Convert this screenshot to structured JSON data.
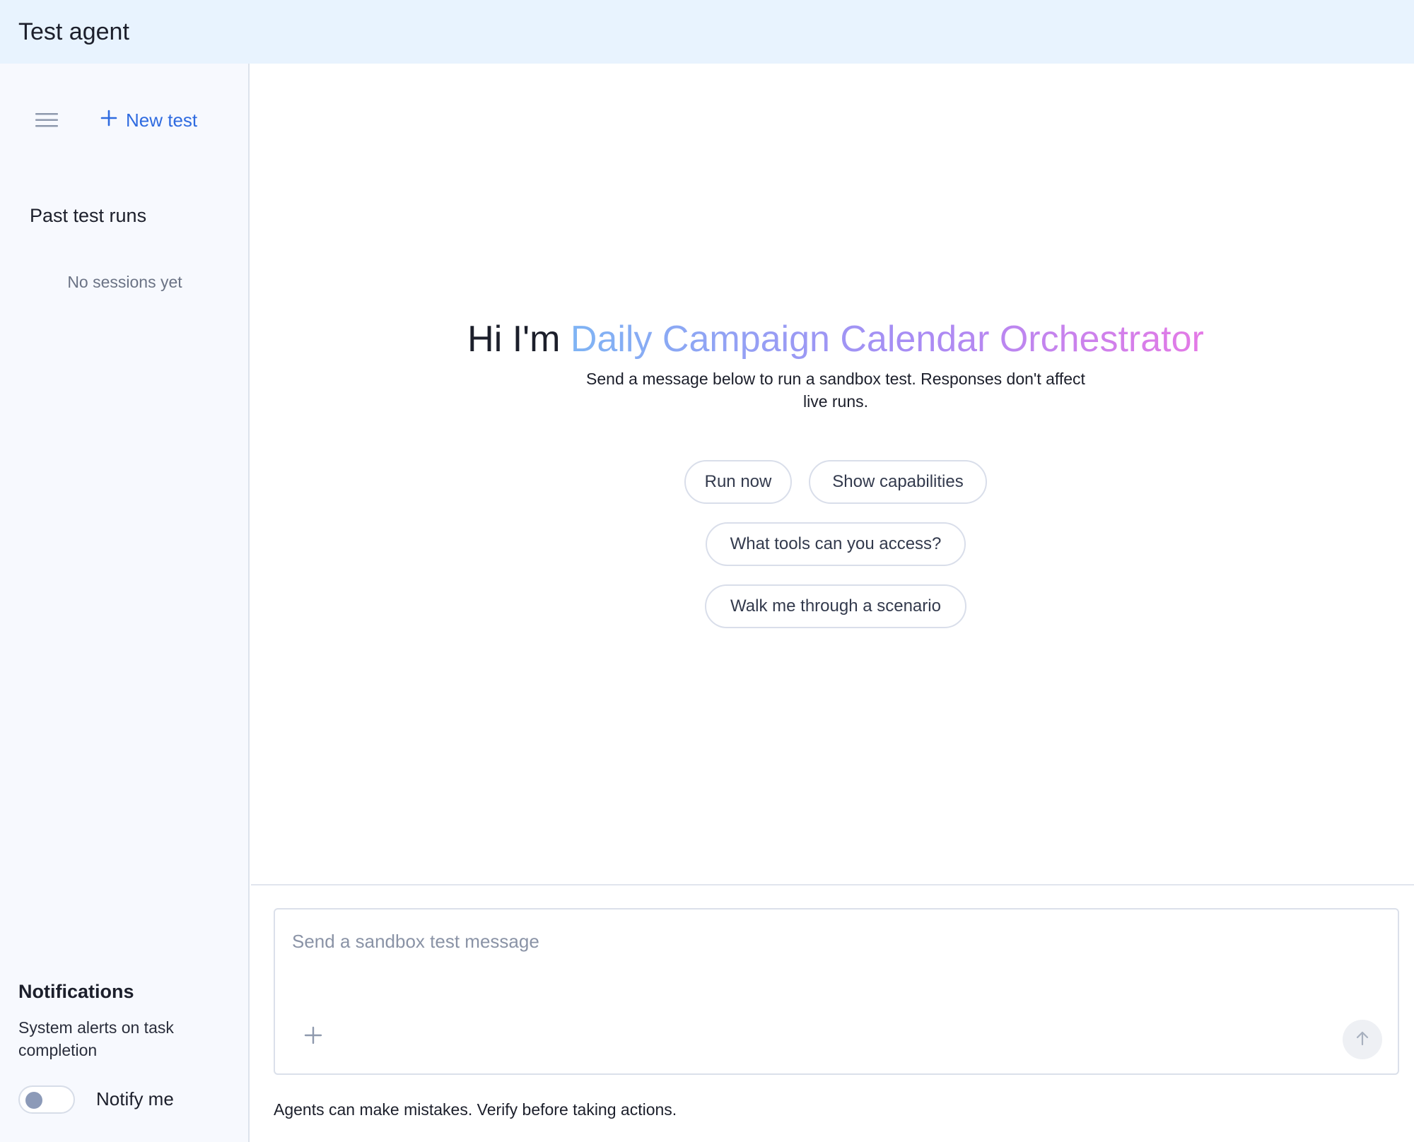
{
  "header": {
    "title": "Test agent"
  },
  "sidebar": {
    "menu_icon": "hamburger-menu-icon",
    "new_test_label": "New test",
    "new_test_icon": "plus-icon",
    "past_runs_title": "Past test runs",
    "empty_state": "No sessions yet",
    "notifications": {
      "title": "Notifications",
      "description": "System alerts on task completion",
      "toggle_label": "Notify me",
      "toggle_on": false
    }
  },
  "main": {
    "greeting_prefix": "Hi I'm",
    "agent_name": "Daily Campaign Calendar Orchestrator",
    "subtitle": "Send a message below to run a sandbox test. Responses don't affect live runs.",
    "suggestions": [
      "Run now",
      "Show capabilities",
      "What tools can you access?",
      "Walk me through a scenario"
    ],
    "composer": {
      "placeholder": "Send a sandbox test message",
      "value": "",
      "attach_icon": "plus-icon",
      "send_icon": "arrow-up-icon"
    },
    "disclaimer": "Agents can make mistakes. Verify before taking actions."
  },
  "colors": {
    "topbar_bg": "#e8f3fe",
    "sidebar_bg": "#f7f9fe",
    "accent": "#2f6be0",
    "gradient_start": "#7fb4f4",
    "gradient_mid": "#a98cf4",
    "gradient_end": "#e47ae6"
  }
}
